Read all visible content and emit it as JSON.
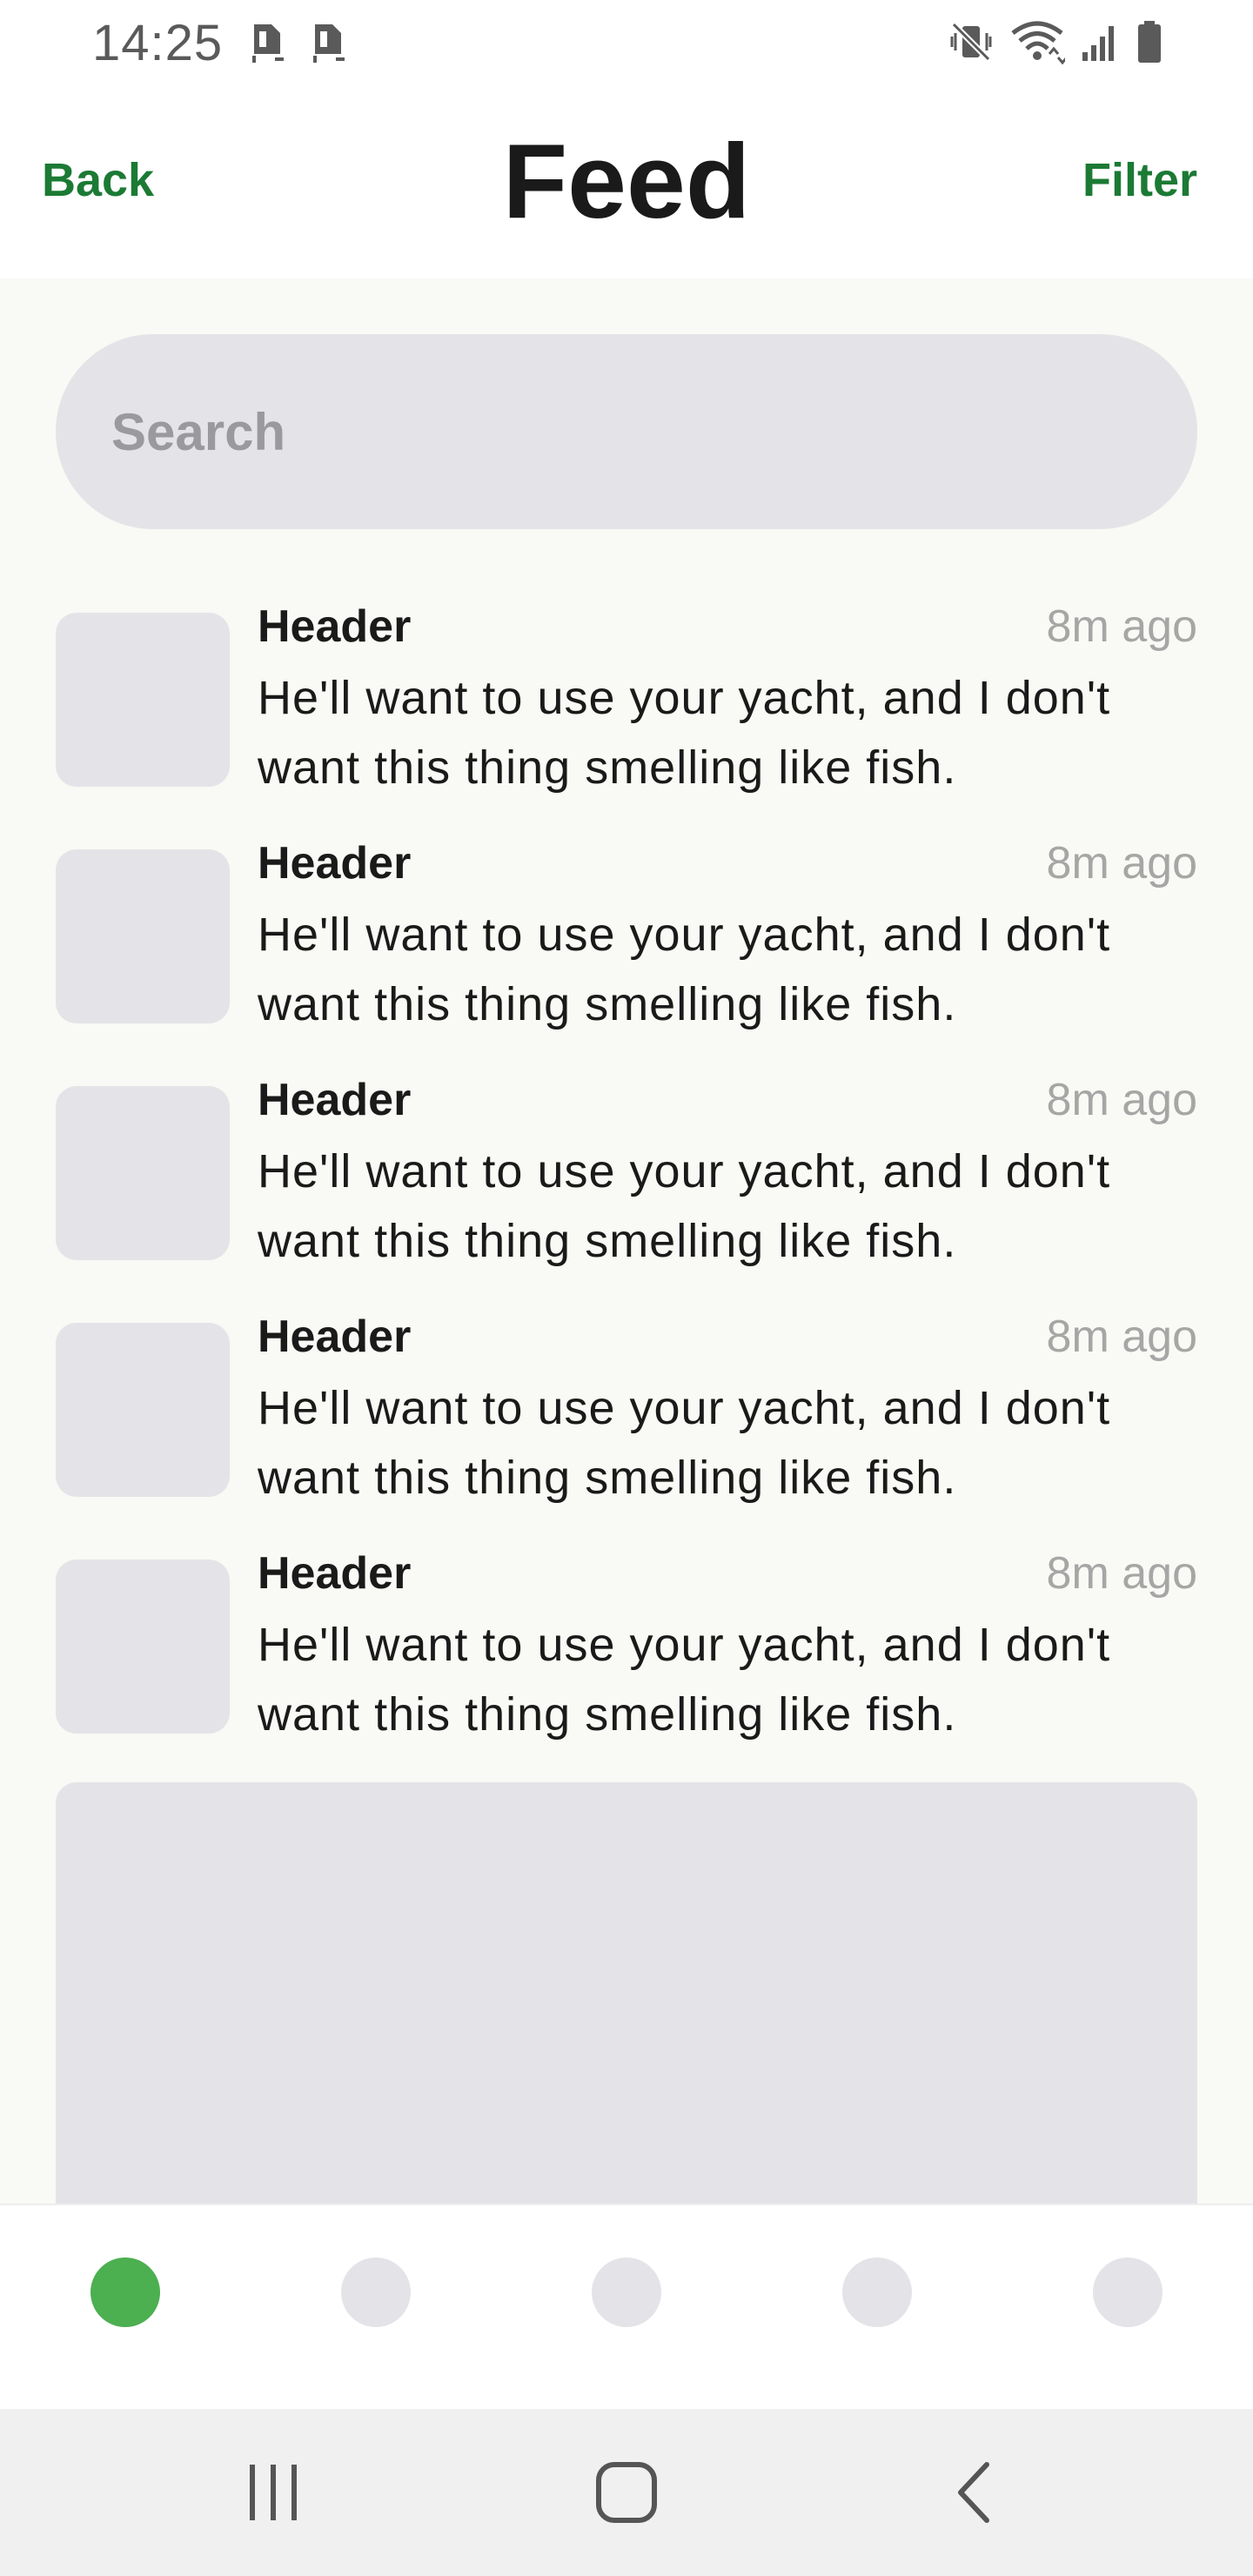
{
  "status_bar": {
    "time": "14:25",
    "left_icons": [
      "sim-card-icon",
      "sim-card-icon"
    ],
    "right_icons": [
      "vibrate-mute-icon",
      "wifi-icon",
      "signal-icon",
      "battery-icon"
    ]
  },
  "nav": {
    "back_label": "Back",
    "title": "Feed",
    "filter_label": "Filter",
    "accent_color": "#1b7a34"
  },
  "search": {
    "placeholder": "Search",
    "value": ""
  },
  "feed": {
    "items": [
      {
        "header": "Header",
        "time": "8m ago",
        "body": "He'll want to use your yacht, and I don't want this thing smelling like fish."
      },
      {
        "header": "Header",
        "time": "8m ago",
        "body": "He'll want to use your yacht, and I don't want this thing smelling like fish."
      },
      {
        "header": "Header",
        "time": "8m ago",
        "body": "He'll want to use your yacht, and I don't want this thing smelling like fish."
      },
      {
        "header": "Header",
        "time": "8m ago",
        "body": "He'll want to use your yacht, and I don't want this thing smelling like fish."
      },
      {
        "header": "Header",
        "time": "8m ago",
        "body": "He'll want to use your yacht, and I don't want this thing smelling like fish."
      }
    ]
  },
  "tab_bar": {
    "active_index": 0,
    "active_color": "#4caf50",
    "inactive_color": "#e4e4e8",
    "tab_count": 5
  },
  "system_nav": {
    "buttons": [
      "recent-apps-icon",
      "home-icon",
      "back-icon"
    ]
  }
}
